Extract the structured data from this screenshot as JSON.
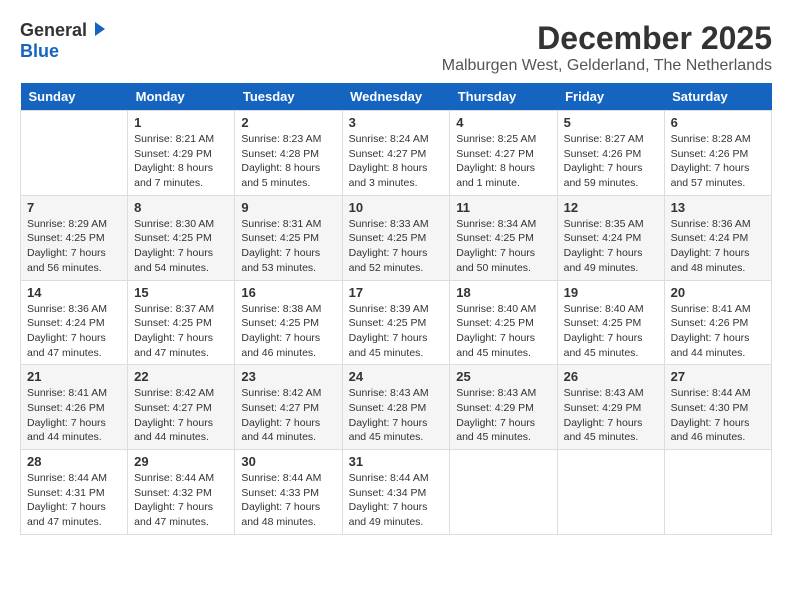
{
  "logo": {
    "line1": "General",
    "line2": "Blue"
  },
  "title": {
    "month": "December 2025",
    "location": "Malburgen West, Gelderland, The Netherlands"
  },
  "headers": [
    "Sunday",
    "Monday",
    "Tuesday",
    "Wednesday",
    "Thursday",
    "Friday",
    "Saturday"
  ],
  "weeks": [
    [
      {
        "day": "",
        "sunrise": "",
        "sunset": "",
        "daylight": ""
      },
      {
        "day": "1",
        "sunrise": "Sunrise: 8:21 AM",
        "sunset": "Sunset: 4:29 PM",
        "daylight": "Daylight: 8 hours and 7 minutes."
      },
      {
        "day": "2",
        "sunrise": "Sunrise: 8:23 AM",
        "sunset": "Sunset: 4:28 PM",
        "daylight": "Daylight: 8 hours and 5 minutes."
      },
      {
        "day": "3",
        "sunrise": "Sunrise: 8:24 AM",
        "sunset": "Sunset: 4:27 PM",
        "daylight": "Daylight: 8 hours and 3 minutes."
      },
      {
        "day": "4",
        "sunrise": "Sunrise: 8:25 AM",
        "sunset": "Sunset: 4:27 PM",
        "daylight": "Daylight: 8 hours and 1 minute."
      },
      {
        "day": "5",
        "sunrise": "Sunrise: 8:27 AM",
        "sunset": "Sunset: 4:26 PM",
        "daylight": "Daylight: 7 hours and 59 minutes."
      },
      {
        "day": "6",
        "sunrise": "Sunrise: 8:28 AM",
        "sunset": "Sunset: 4:26 PM",
        "daylight": "Daylight: 7 hours and 57 minutes."
      }
    ],
    [
      {
        "day": "7",
        "sunrise": "Sunrise: 8:29 AM",
        "sunset": "Sunset: 4:25 PM",
        "daylight": "Daylight: 7 hours and 56 minutes."
      },
      {
        "day": "8",
        "sunrise": "Sunrise: 8:30 AM",
        "sunset": "Sunset: 4:25 PM",
        "daylight": "Daylight: 7 hours and 54 minutes."
      },
      {
        "day": "9",
        "sunrise": "Sunrise: 8:31 AM",
        "sunset": "Sunset: 4:25 PM",
        "daylight": "Daylight: 7 hours and 53 minutes."
      },
      {
        "day": "10",
        "sunrise": "Sunrise: 8:33 AM",
        "sunset": "Sunset: 4:25 PM",
        "daylight": "Daylight: 7 hours and 52 minutes."
      },
      {
        "day": "11",
        "sunrise": "Sunrise: 8:34 AM",
        "sunset": "Sunset: 4:25 PM",
        "daylight": "Daylight: 7 hours and 50 minutes."
      },
      {
        "day": "12",
        "sunrise": "Sunrise: 8:35 AM",
        "sunset": "Sunset: 4:24 PM",
        "daylight": "Daylight: 7 hours and 49 minutes."
      },
      {
        "day": "13",
        "sunrise": "Sunrise: 8:36 AM",
        "sunset": "Sunset: 4:24 PM",
        "daylight": "Daylight: 7 hours and 48 minutes."
      }
    ],
    [
      {
        "day": "14",
        "sunrise": "Sunrise: 8:36 AM",
        "sunset": "Sunset: 4:24 PM",
        "daylight": "Daylight: 7 hours and 47 minutes."
      },
      {
        "day": "15",
        "sunrise": "Sunrise: 8:37 AM",
        "sunset": "Sunset: 4:25 PM",
        "daylight": "Daylight: 7 hours and 47 minutes."
      },
      {
        "day": "16",
        "sunrise": "Sunrise: 8:38 AM",
        "sunset": "Sunset: 4:25 PM",
        "daylight": "Daylight: 7 hours and 46 minutes."
      },
      {
        "day": "17",
        "sunrise": "Sunrise: 8:39 AM",
        "sunset": "Sunset: 4:25 PM",
        "daylight": "Daylight: 7 hours and 45 minutes."
      },
      {
        "day": "18",
        "sunrise": "Sunrise: 8:40 AM",
        "sunset": "Sunset: 4:25 PM",
        "daylight": "Daylight: 7 hours and 45 minutes."
      },
      {
        "day": "19",
        "sunrise": "Sunrise: 8:40 AM",
        "sunset": "Sunset: 4:25 PM",
        "daylight": "Daylight: 7 hours and 45 minutes."
      },
      {
        "day": "20",
        "sunrise": "Sunrise: 8:41 AM",
        "sunset": "Sunset: 4:26 PM",
        "daylight": "Daylight: 7 hours and 44 minutes."
      }
    ],
    [
      {
        "day": "21",
        "sunrise": "Sunrise: 8:41 AM",
        "sunset": "Sunset: 4:26 PM",
        "daylight": "Daylight: 7 hours and 44 minutes."
      },
      {
        "day": "22",
        "sunrise": "Sunrise: 8:42 AM",
        "sunset": "Sunset: 4:27 PM",
        "daylight": "Daylight: 7 hours and 44 minutes."
      },
      {
        "day": "23",
        "sunrise": "Sunrise: 8:42 AM",
        "sunset": "Sunset: 4:27 PM",
        "daylight": "Daylight: 7 hours and 44 minutes."
      },
      {
        "day": "24",
        "sunrise": "Sunrise: 8:43 AM",
        "sunset": "Sunset: 4:28 PM",
        "daylight": "Daylight: 7 hours and 45 minutes."
      },
      {
        "day": "25",
        "sunrise": "Sunrise: 8:43 AM",
        "sunset": "Sunset: 4:29 PM",
        "daylight": "Daylight: 7 hours and 45 minutes."
      },
      {
        "day": "26",
        "sunrise": "Sunrise: 8:43 AM",
        "sunset": "Sunset: 4:29 PM",
        "daylight": "Daylight: 7 hours and 45 minutes."
      },
      {
        "day": "27",
        "sunrise": "Sunrise: 8:44 AM",
        "sunset": "Sunset: 4:30 PM",
        "daylight": "Daylight: 7 hours and 46 minutes."
      }
    ],
    [
      {
        "day": "28",
        "sunrise": "Sunrise: 8:44 AM",
        "sunset": "Sunset: 4:31 PM",
        "daylight": "Daylight: 7 hours and 47 minutes."
      },
      {
        "day": "29",
        "sunrise": "Sunrise: 8:44 AM",
        "sunset": "Sunset: 4:32 PM",
        "daylight": "Daylight: 7 hours and 47 minutes."
      },
      {
        "day": "30",
        "sunrise": "Sunrise: 8:44 AM",
        "sunset": "Sunset: 4:33 PM",
        "daylight": "Daylight: 7 hours and 48 minutes."
      },
      {
        "day": "31",
        "sunrise": "Sunrise: 8:44 AM",
        "sunset": "Sunset: 4:34 PM",
        "daylight": "Daylight: 7 hours and 49 minutes."
      },
      {
        "day": "",
        "sunrise": "",
        "sunset": "",
        "daylight": ""
      },
      {
        "day": "",
        "sunrise": "",
        "sunset": "",
        "daylight": ""
      },
      {
        "day": "",
        "sunrise": "",
        "sunset": "",
        "daylight": ""
      }
    ]
  ]
}
